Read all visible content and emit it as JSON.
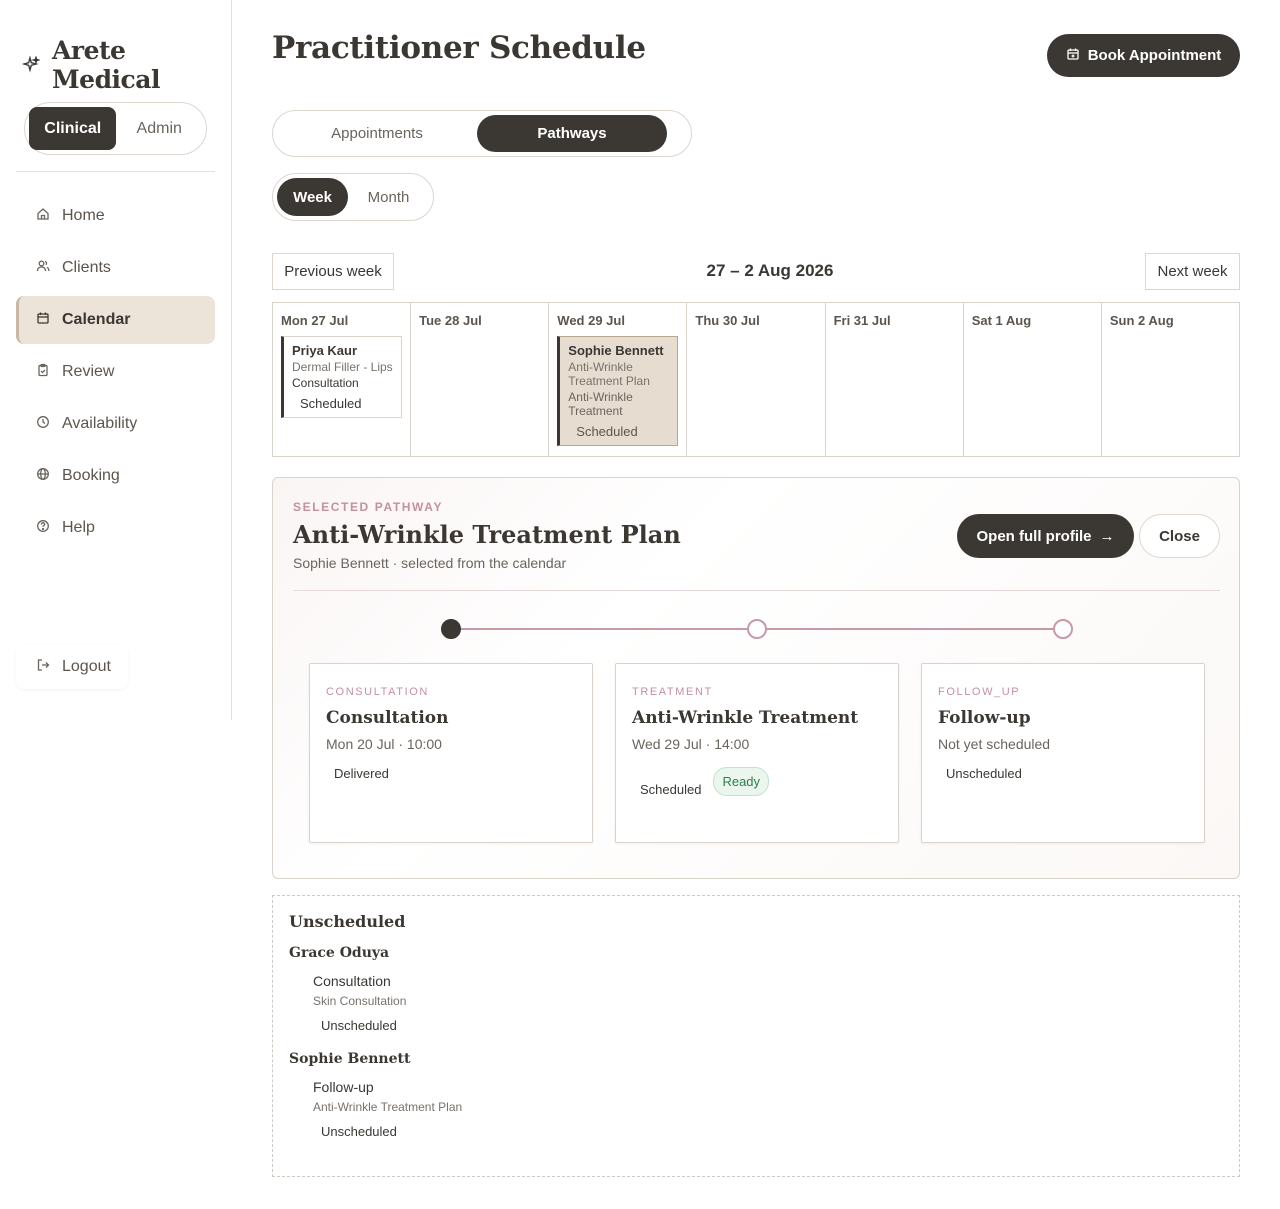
{
  "sidebar": {
    "brand": "Arete Medical",
    "brand_icon": "sparkle-icon",
    "modes": [
      {
        "label": "Clinical",
        "active": true
      },
      {
        "label": "Admin",
        "active": false
      }
    ],
    "nav": [
      {
        "label": "Home",
        "icon": "home-icon"
      },
      {
        "label": "Clients",
        "icon": "users-icon"
      },
      {
        "label": "Calendar",
        "icon": "calendar-icon",
        "active": true
      },
      {
        "label": "Review",
        "icon": "clipboard-icon"
      },
      {
        "label": "Availability",
        "icon": "clock-icon"
      },
      {
        "label": "Booking",
        "icon": "globe-icon"
      },
      {
        "label": "Help",
        "icon": "help-circle-icon"
      }
    ],
    "logout": "Logout"
  },
  "header": {
    "title": "Practitioner Schedule",
    "book_button": "Book Appointment"
  },
  "view_tabs": [
    {
      "label": "Appointments",
      "active": false
    },
    {
      "label": "Pathways",
      "active": true
    }
  ],
  "range_tabs": [
    {
      "label": "Week",
      "active": true
    },
    {
      "label": "Month",
      "active": false
    }
  ],
  "week_nav": {
    "prev": "Previous week",
    "label": "27 – 2 Aug 2026",
    "next": "Next week"
  },
  "calendar": {
    "days": [
      {
        "label": "Mon 27 Jul"
      },
      {
        "label": "Tue 28 Jul"
      },
      {
        "label": "Wed 29 Jul"
      },
      {
        "label": "Thu 30 Jul"
      },
      {
        "label": "Fri 31 Jul"
      },
      {
        "label": "Sat 1 Aug"
      },
      {
        "label": "Sun 2 Aug"
      }
    ],
    "events": [
      {
        "client": "Priya Kaur",
        "service": "Dermal Filler - Lips",
        "kind": "Consultation",
        "status": "Scheduled"
      },
      {
        "client": "Sophie Bennett",
        "service": "Anti-Wrinkle Treatment Plan",
        "kind": "Anti-Wrinkle Treatment",
        "status": "Scheduled"
      }
    ]
  },
  "pathway": {
    "eyebrow": "SELECTED PATHWAY",
    "title": "Anti-Wrinkle Treatment Plan",
    "subtitle": "Sophie Bennett · selected from the calendar",
    "open_button": "Open full profile",
    "open_arrow": "→",
    "close_button": "Close",
    "steps": [
      {
        "eyebrow": "CONSULTATION",
        "name": "Consultation",
        "date": "Mon 20 Jul · 10:00",
        "status": "Delivered",
        "done": true
      },
      {
        "eyebrow": "TREATMENT",
        "name": "Anti-Wrinkle Treatment",
        "date": "Wed 29 Jul · 14:00",
        "status": "Scheduled",
        "badge": "Ready",
        "badge_color": "#2e7d4f",
        "done": false
      },
      {
        "eyebrow": "FOLLOW_UP",
        "name": "Follow-up",
        "date": "Not yet scheduled",
        "status": "Unscheduled",
        "done": false
      }
    ]
  },
  "unscheduled": {
    "title": "Unscheduled",
    "groups": [
      {
        "client": "Grace Oduya",
        "items": [
          {
            "kind": "Consultation",
            "service": "Skin Consultation",
            "status": "Unscheduled"
          }
        ]
      },
      {
        "client": "Sophie Bennett",
        "items": [
          {
            "kind": "Follow-up",
            "service": "Anti-Wrinkle Treatment Plan",
            "status": "Unscheduled"
          }
        ]
      }
    ]
  },
  "colors": {
    "primary": "#3b3733",
    "accent_rose": "#c4919e",
    "selected_bg": "#ece4d8",
    "ready_green": "#2e7d4f"
  }
}
